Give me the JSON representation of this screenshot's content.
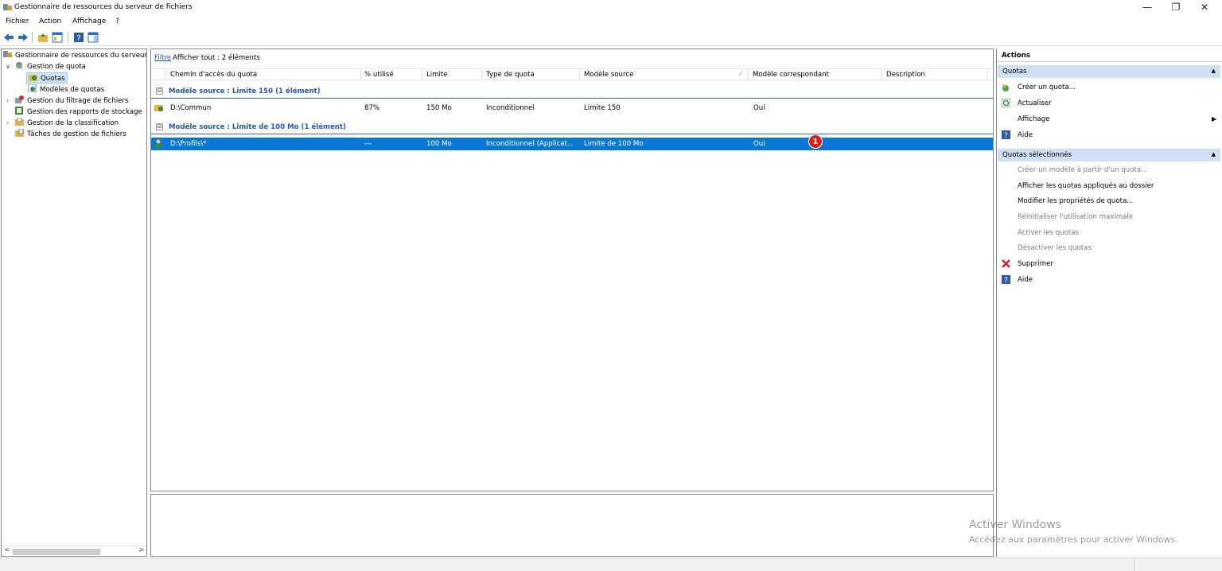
{
  "window": {
    "title": "Gestionnaire de ressources du serveur de fichiers",
    "minimize": "—",
    "restore": "❐",
    "close": "✕"
  },
  "menu": [
    "Fichier",
    "Action",
    "Affichage",
    "?"
  ],
  "tree": {
    "root": "Gestionnaire de ressources du serveur",
    "items": [
      {
        "label": "Gestion de quota",
        "expander": "∨"
      },
      {
        "label": "Quotas"
      },
      {
        "label": "Modèles de quotas"
      },
      {
        "label": "Gestion du filtrage de fichiers",
        "expander": "›"
      },
      {
        "label": "Gestion des rapports de stockage"
      },
      {
        "label": "Gestion de la classification",
        "expander": "›"
      },
      {
        "label": "Tâches de gestion de fichiers"
      }
    ],
    "scroll_left": "<",
    "scroll_right": ">"
  },
  "filterbar": {
    "link": "Filtre",
    "text": "Afficher tout : 2 éléments"
  },
  "columns": [
    "Chemin d'accès du quota",
    "% utilisé",
    "Limite",
    "Type de quota",
    "Modèle source",
    "Modèle correspondant",
    "Description"
  ],
  "sort_indicator": "⁄",
  "groups": [
    {
      "label": "Modèle source : Limite 150 (1 élément)",
      "toggle": "⊟",
      "rows": [
        {
          "path": "D:\\Commun",
          "used": "87%",
          "limit": "150 Mo",
          "type": "Inconditionnel",
          "source": "Limite 150",
          "match": "Oui",
          "description": ""
        }
      ]
    },
    {
      "label": "Modèle source : Limite de 100 Mo (1 élément)",
      "toggle": "⊟",
      "rows": [
        {
          "path": "D:\\Profils\\*",
          "used": "---",
          "limit": "100 Mo",
          "type": "Inconditionnel (Applicat...",
          "source": "Limite de 100 Mo",
          "match": "Oui",
          "description": "",
          "selected": true
        }
      ]
    }
  ],
  "badge": "1",
  "actions": {
    "header": "Actions",
    "sections": [
      {
        "title": "Quotas",
        "items": [
          {
            "label": "Créer un quota...",
            "enabled": true,
            "icon": "create-quota-icon"
          },
          {
            "label": "Actualiser",
            "enabled": true,
            "icon": "refresh-icon"
          },
          {
            "label": "Affichage",
            "enabled": true,
            "submenu": "▶"
          },
          {
            "label": "Aide",
            "enabled": true,
            "icon": "help-icon"
          }
        ]
      },
      {
        "title": "Quotas sélectionnés",
        "items": [
          {
            "label": "Créer un modèle à partir d'un quota...",
            "enabled": false
          },
          {
            "label": "Afficher les quotas appliqués au dossier",
            "enabled": true
          },
          {
            "label": "Modifier les propriétés de quota...",
            "enabled": true
          },
          {
            "label": "Réinitialiser l'utilisation maximale",
            "enabled": false
          },
          {
            "label": "Activer les quotas",
            "enabled": false
          },
          {
            "label": "Désactiver les quotas",
            "enabled": false
          },
          {
            "label": "Supprimer",
            "enabled": true,
            "icon": "delete-icon"
          },
          {
            "label": "Aide",
            "enabled": true,
            "icon": "help-icon"
          }
        ]
      }
    ],
    "collapse": "▲"
  },
  "watermark": {
    "line1": "Activer Windows",
    "line2": "Accédez aux paramètres pour activer Windows."
  },
  "colors": {
    "selection": "#0a78d7",
    "group_text": "#2458b8",
    "section_bg": "#cfe0f4",
    "badge": "#d9201e"
  }
}
